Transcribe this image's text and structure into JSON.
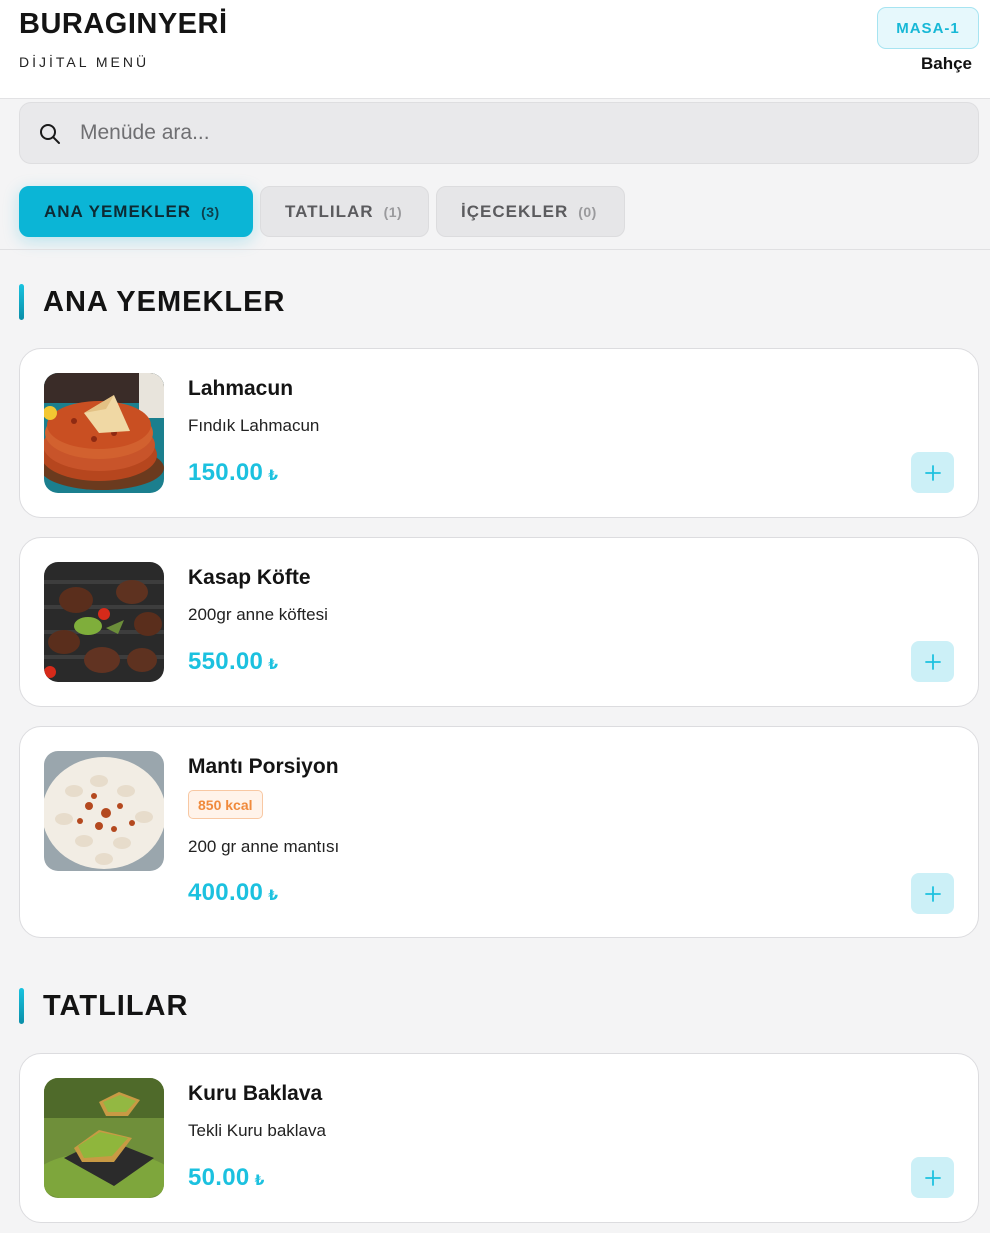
{
  "header": {
    "brand": "BURAGINYERİ",
    "subtitle": "DİJİTAL MENÜ",
    "table": "MASA-1",
    "area": "Bahçe"
  },
  "search": {
    "placeholder": "Menüde ara...",
    "icon": "search-icon"
  },
  "tabs": [
    {
      "label": "ANA YEMEKLER",
      "count": "(3)",
      "active": true
    },
    {
      "label": "TATLILAR",
      "count": "(1)",
      "active": false
    },
    {
      "label": "İÇECEKLER",
      "count": "(0)",
      "active": false
    }
  ],
  "sections": [
    {
      "title": "ANA YEMEKLER",
      "items": [
        {
          "name": "Lahmacun",
          "description": "Fındık Lahmacun",
          "price": "150.00",
          "currency": "₺",
          "image": "lahmacun-photo"
        },
        {
          "name": "Kasap Köfte",
          "description": "200gr anne köftesi",
          "price": "550.00",
          "currency": "₺",
          "image": "kofte-photo"
        },
        {
          "name": "Mantı Porsiyon",
          "badge": "850 kcal",
          "description": "200 gr anne mantısı",
          "price": "400.00",
          "currency": "₺",
          "image": "manti-photo"
        }
      ]
    },
    {
      "title": "TATLILAR",
      "items": [
        {
          "name": "Kuru Baklava",
          "description": "Tekli Kuru baklava",
          "price": "50.00",
          "currency": "₺",
          "image": "baklava-photo"
        }
      ]
    }
  ],
  "colors": {
    "accent": "#0bb5d6",
    "price": "#1cc1df",
    "kcal": "#f08a3c",
    "background": "#f4f4f5"
  }
}
